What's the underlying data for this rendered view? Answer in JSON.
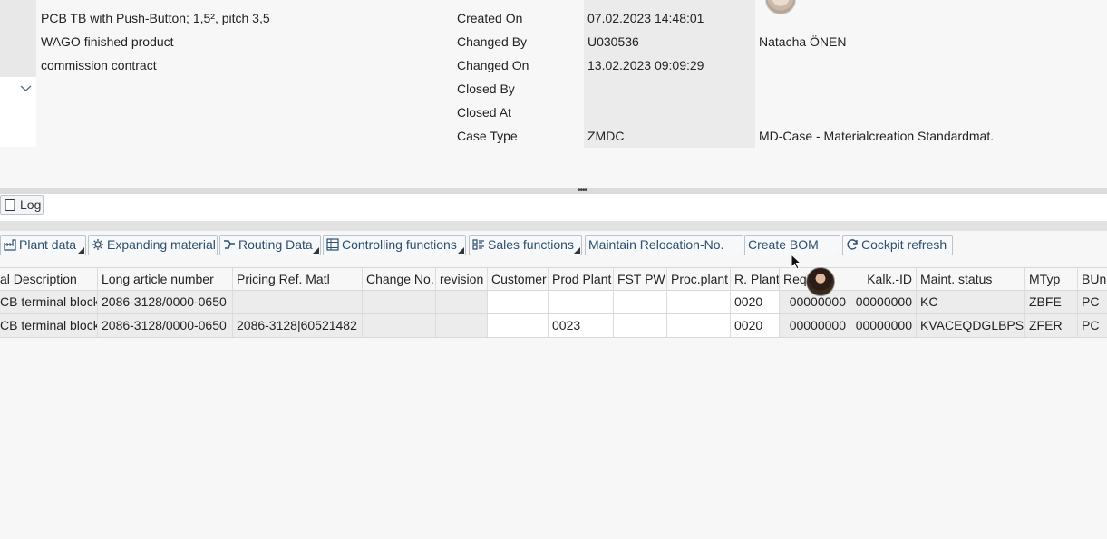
{
  "header": {
    "desc_lines": [
      "PCB TB with Push-Button; 1,5², pitch 3,5",
      "WAGO finished product",
      "commission contract"
    ],
    "fields": [
      {
        "label": "Created On",
        "value": "07.02.2023 14:48:01",
        "extra": ""
      },
      {
        "label": "Changed By",
        "value": "U030536",
        "extra": "Natacha ÖNEN"
      },
      {
        "label": "Changed On",
        "value": "13.02.2023 09:09:29",
        "extra": ""
      },
      {
        "label": "Closed By",
        "value": "",
        "extra": ""
      },
      {
        "label": "Closed At",
        "value": "",
        "extra": ""
      },
      {
        "label": "Case Type",
        "value": "ZMDC",
        "extra": "MD-Case - Materialcreation Standardmat."
      }
    ]
  },
  "log_button": {
    "label": "Log",
    "icon": "log-icon"
  },
  "toolbar": {
    "buttons": [
      {
        "label": "Plant data",
        "icon": "plant-icon",
        "menu": true
      },
      {
        "label": "Expanding material",
        "icon": "gear-icon",
        "menu": false
      },
      {
        "label": "Routing Data",
        "icon": "routing-icon",
        "menu": true
      },
      {
        "label": "Controlling functions",
        "icon": "table-icon",
        "menu": true
      },
      {
        "label": "Sales functions",
        "icon": "sales-icon",
        "menu": true
      },
      {
        "label": "Maintain Relocation-No.",
        "icon": "",
        "menu": false
      },
      {
        "label": "Create BOM",
        "icon": "",
        "menu": false
      },
      {
        "label": "Cockpit refresh",
        "icon": "refresh-icon",
        "menu": false
      }
    ]
  },
  "table": {
    "columns": [
      "al Description",
      "Long article number",
      "Pricing Ref. Matl",
      "Change No.",
      "revision",
      "Customer",
      "Prod Plant",
      "FST PW",
      "Proc.plant",
      "R. Plant",
      "Req.-ID",
      "Kalk.-ID",
      "Maint. status",
      "MTyp",
      "BUn"
    ],
    "rows": [
      [
        "CB terminal block",
        "2086-3128/0000-0650",
        "",
        "",
        "",
        "",
        "",
        "",
        "",
        "0020",
        "00000000",
        "00000000",
        "KC",
        "ZBFE",
        "PC"
      ],
      [
        "CB terminal block",
        "2086-3128/0000-0650",
        "2086-3128|60521482",
        "",
        "",
        "",
        "0023",
        "",
        "",
        "0020",
        "00000000",
        "00000000",
        "KVACEQDGLBPS",
        "ZFER",
        "PC"
      ]
    ]
  },
  "colors": {
    "toolbar_text": "#2c4e6f",
    "button_border": "#bcc3cb"
  }
}
